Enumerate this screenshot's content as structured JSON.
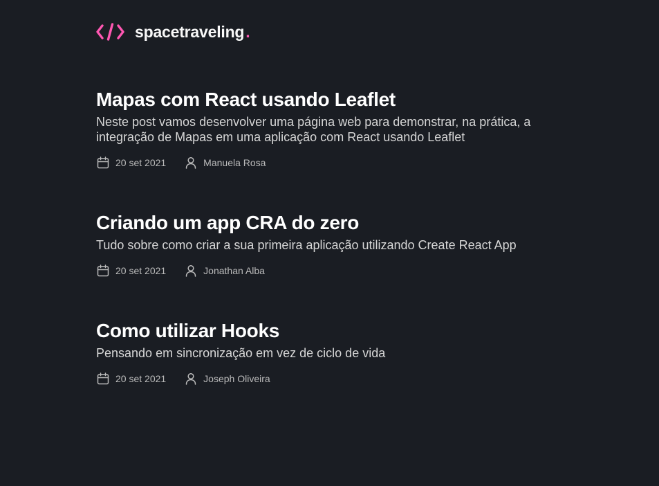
{
  "header": {
    "logo_icon": "code-brackets-icon",
    "brand_name": "spacetraveling",
    "brand_dot": ".",
    "accent_color": "#ff57b2"
  },
  "posts": [
    {
      "title": "Mapas com React usando Leaflet",
      "subtitle": "Neste post vamos desenvolver uma página web para demonstrar, na prática, a integração de Mapas em uma aplicação com React usando Leaflet",
      "date": "20 set 2021",
      "author": "Manuela Rosa",
      "date_icon": "calendar-icon",
      "author_icon": "user-icon"
    },
    {
      "title": "Criando um app CRA do zero",
      "subtitle": "Tudo sobre como criar a sua primeira aplicação utilizando Create React App",
      "date": "20 set 2021",
      "author": "Jonathan Alba",
      "date_icon": "calendar-icon",
      "author_icon": "user-icon"
    },
    {
      "title": "Como utilizar Hooks",
      "subtitle": "Pensando em sincronização em vez de ciclo de vida",
      "date": "20 set 2021",
      "author": "Joseph Oliveira",
      "date_icon": "calendar-icon",
      "author_icon": "user-icon"
    }
  ],
  "colors": {
    "background": "#1a1d23",
    "title": "#ffffff",
    "subtitle": "#d7d7d7",
    "info": "#bbbbbb"
  }
}
